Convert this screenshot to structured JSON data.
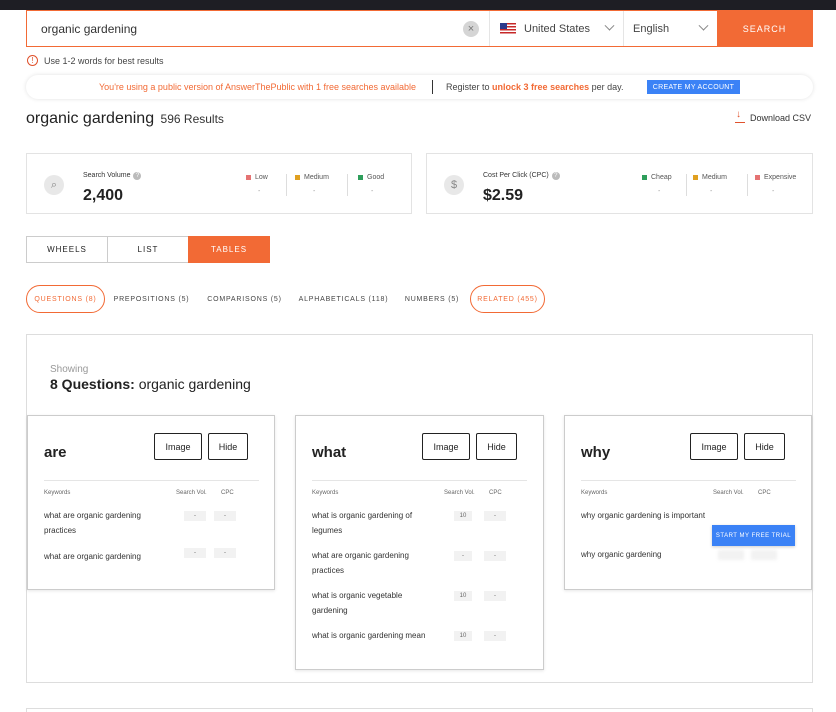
{
  "search": {
    "query": "organic gardening",
    "country": "United States",
    "language": "English",
    "button": "SEARCH",
    "hint": "Use 1-2 words for best results"
  },
  "banner": {
    "public_text": "You're using a public version of AnswerThePublic with 1 free searches available",
    "register_pre": "Register to",
    "register_bold": "unlock 3 free searches",
    "register_post": "per day.",
    "cta": "CREATE MY ACCOUNT"
  },
  "results": {
    "term": "organic gardening",
    "count": "596 Results",
    "download": "Download CSV"
  },
  "metrics": {
    "volume": {
      "label": "Search Volume",
      "value": "2,400",
      "levels": [
        {
          "name": "Low",
          "color": "#e57373",
          "value": "-"
        },
        {
          "name": "Medium",
          "color": "#e0a020",
          "value": "-"
        },
        {
          "name": "Good",
          "color": "#2e9e5b",
          "value": "-"
        }
      ]
    },
    "cpc": {
      "label": "Cost Per Click (CPC)",
      "value": "$2.59",
      "levels": [
        {
          "name": "Cheap",
          "color": "#2e9e5b",
          "value": "-"
        },
        {
          "name": "Medium",
          "color": "#e0a020",
          "value": "-"
        },
        {
          "name": "Expensive",
          "color": "#e57373",
          "value": "-"
        }
      ]
    }
  },
  "view_tabs": [
    "WHEELS",
    "LIST",
    "TABLES"
  ],
  "active_view": "TABLES",
  "categories": [
    "QUESTIONS (8)",
    "PREPOSITIONS (5)",
    "COMPARISONS (5)",
    "ALPHABETICALS (118)",
    "NUMBERS (5)",
    "RELATED (455)"
  ],
  "showing": {
    "label": "Showing",
    "count": "8 Questions:",
    "term": "organic gardening"
  },
  "card_labels": {
    "image": "Image",
    "hide": "Hide",
    "keywords": "Keywords",
    "search_vol": "Search Vol.",
    "cpc": "CPC",
    "trial": "START MY FREE TRIAL"
  },
  "cards": [
    {
      "word": "are",
      "rows": [
        {
          "keyword": "what are organic gardening practices",
          "vol": "-",
          "cpc": "-"
        },
        {
          "keyword": "what are organic gardening",
          "vol": "-",
          "cpc": "-"
        }
      ]
    },
    {
      "word": "what",
      "rows": [
        {
          "keyword": "what is organic gardening of legumes",
          "vol": "10",
          "cpc": "-"
        },
        {
          "keyword": "what are organic gardening practices",
          "vol": "-",
          "cpc": "-"
        },
        {
          "keyword": "what is organic vegetable gardening",
          "vol": "10",
          "cpc": "-"
        },
        {
          "keyword": "what is organic gardening mean",
          "vol": "10",
          "cpc": "-"
        }
      ]
    },
    {
      "word": "why",
      "rows": [
        {
          "keyword": "why organic gardening is important",
          "vol": "",
          "cpc": ""
        },
        {
          "keyword": "why organic gardening",
          "vol": "",
          "cpc": ""
        }
      ]
    }
  ]
}
